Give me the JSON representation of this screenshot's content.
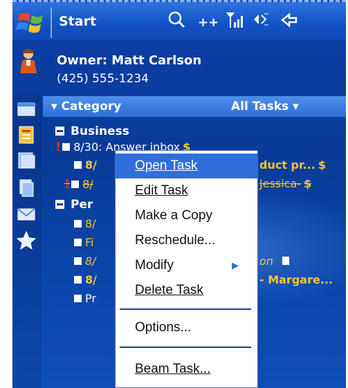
{
  "topbar": {
    "start_label": "Start",
    "icons": [
      "search-icon",
      "connectivity-icon",
      "signal-icon",
      "volume-icon",
      "sync-icon"
    ]
  },
  "owner": {
    "name": "Owner: Matt Carlson",
    "phone": "(425) 555-1234"
  },
  "category_bar": {
    "label": "Category",
    "filter": "All Tasks"
  },
  "groups": [
    {
      "name": "Business",
      "tasks": [
        {
          "text": "8/30: Answer inbox",
          "priority": "high",
          "color": "#ffffff"
        },
        {
          "text": "8/",
          "trailing": "duct pr...",
          "color": "#f3c433"
        },
        {
          "text": "8/",
          "trailing": "Jessica-",
          "color": "#f3c433",
          "completed": true,
          "priority": "high"
        }
      ]
    },
    {
      "name": "Per",
      "tasks": [
        {
          "text": "8/",
          "color": "#f3c433"
        },
        {
          "text": "Fi",
          "color": "#f3c433"
        },
        {
          "text": "8/",
          "trailing": "on",
          "color": "#f3c433"
        },
        {
          "text": "8/",
          "trailing": "- Margare...",
          "color": "#f3c433"
        },
        {
          "text": "Pr",
          "color": "#ffffff"
        }
      ]
    }
  ],
  "context_menu": {
    "items": [
      {
        "label": "Open Task",
        "selected": true,
        "underline": true
      },
      {
        "label": "Edit Task",
        "underline": true
      },
      {
        "label": "Make a Copy"
      },
      {
        "label": "Reschedule..."
      },
      {
        "label": "Modify",
        "submenu": true
      },
      {
        "label": "Delete Task",
        "underline": true
      },
      {
        "label": "Options..."
      },
      {
        "label": "Beam Task...",
        "underline": true
      }
    ]
  },
  "colors": {
    "background": "#0c3ea6",
    "accent": "#2f6fdb",
    "due_text": "#f3c433",
    "priority": "#e03030"
  }
}
